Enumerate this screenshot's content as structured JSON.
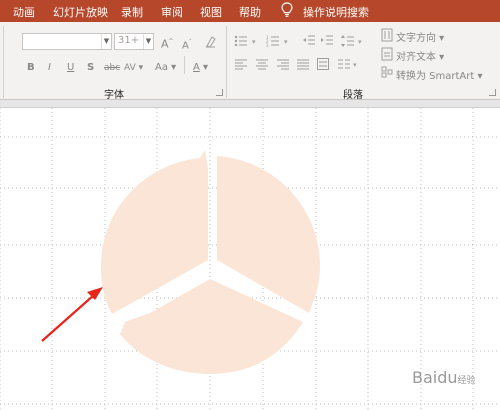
{
  "menu": {
    "items": [
      "动画",
      "幻灯片放映",
      "录制",
      "审阅",
      "视图",
      "帮助"
    ],
    "tell_me": "操作说明搜索"
  },
  "ribbon": {
    "font_group": {
      "label": "字体",
      "font_size": "31+",
      "grow_font": "A",
      "shrink_font": "A",
      "bold": "B",
      "italic": "I",
      "underline": "U",
      "shadow": "S",
      "strikethrough": "abc",
      "char_spacing": "AV",
      "change_case": "Aa",
      "font_color": "A"
    },
    "paragraph_group": {
      "label": "段落",
      "text_direction": "文字方向",
      "align_text": "对齐文本",
      "convert_smartart": "转换为 SmartArt"
    }
  },
  "watermark": {
    "brand": "Baidu",
    "sub": "经验"
  },
  "colors": {
    "menubar": "#b7472a",
    "shape_fill": "#fbe5d6",
    "arrow": "#e8231b"
  }
}
